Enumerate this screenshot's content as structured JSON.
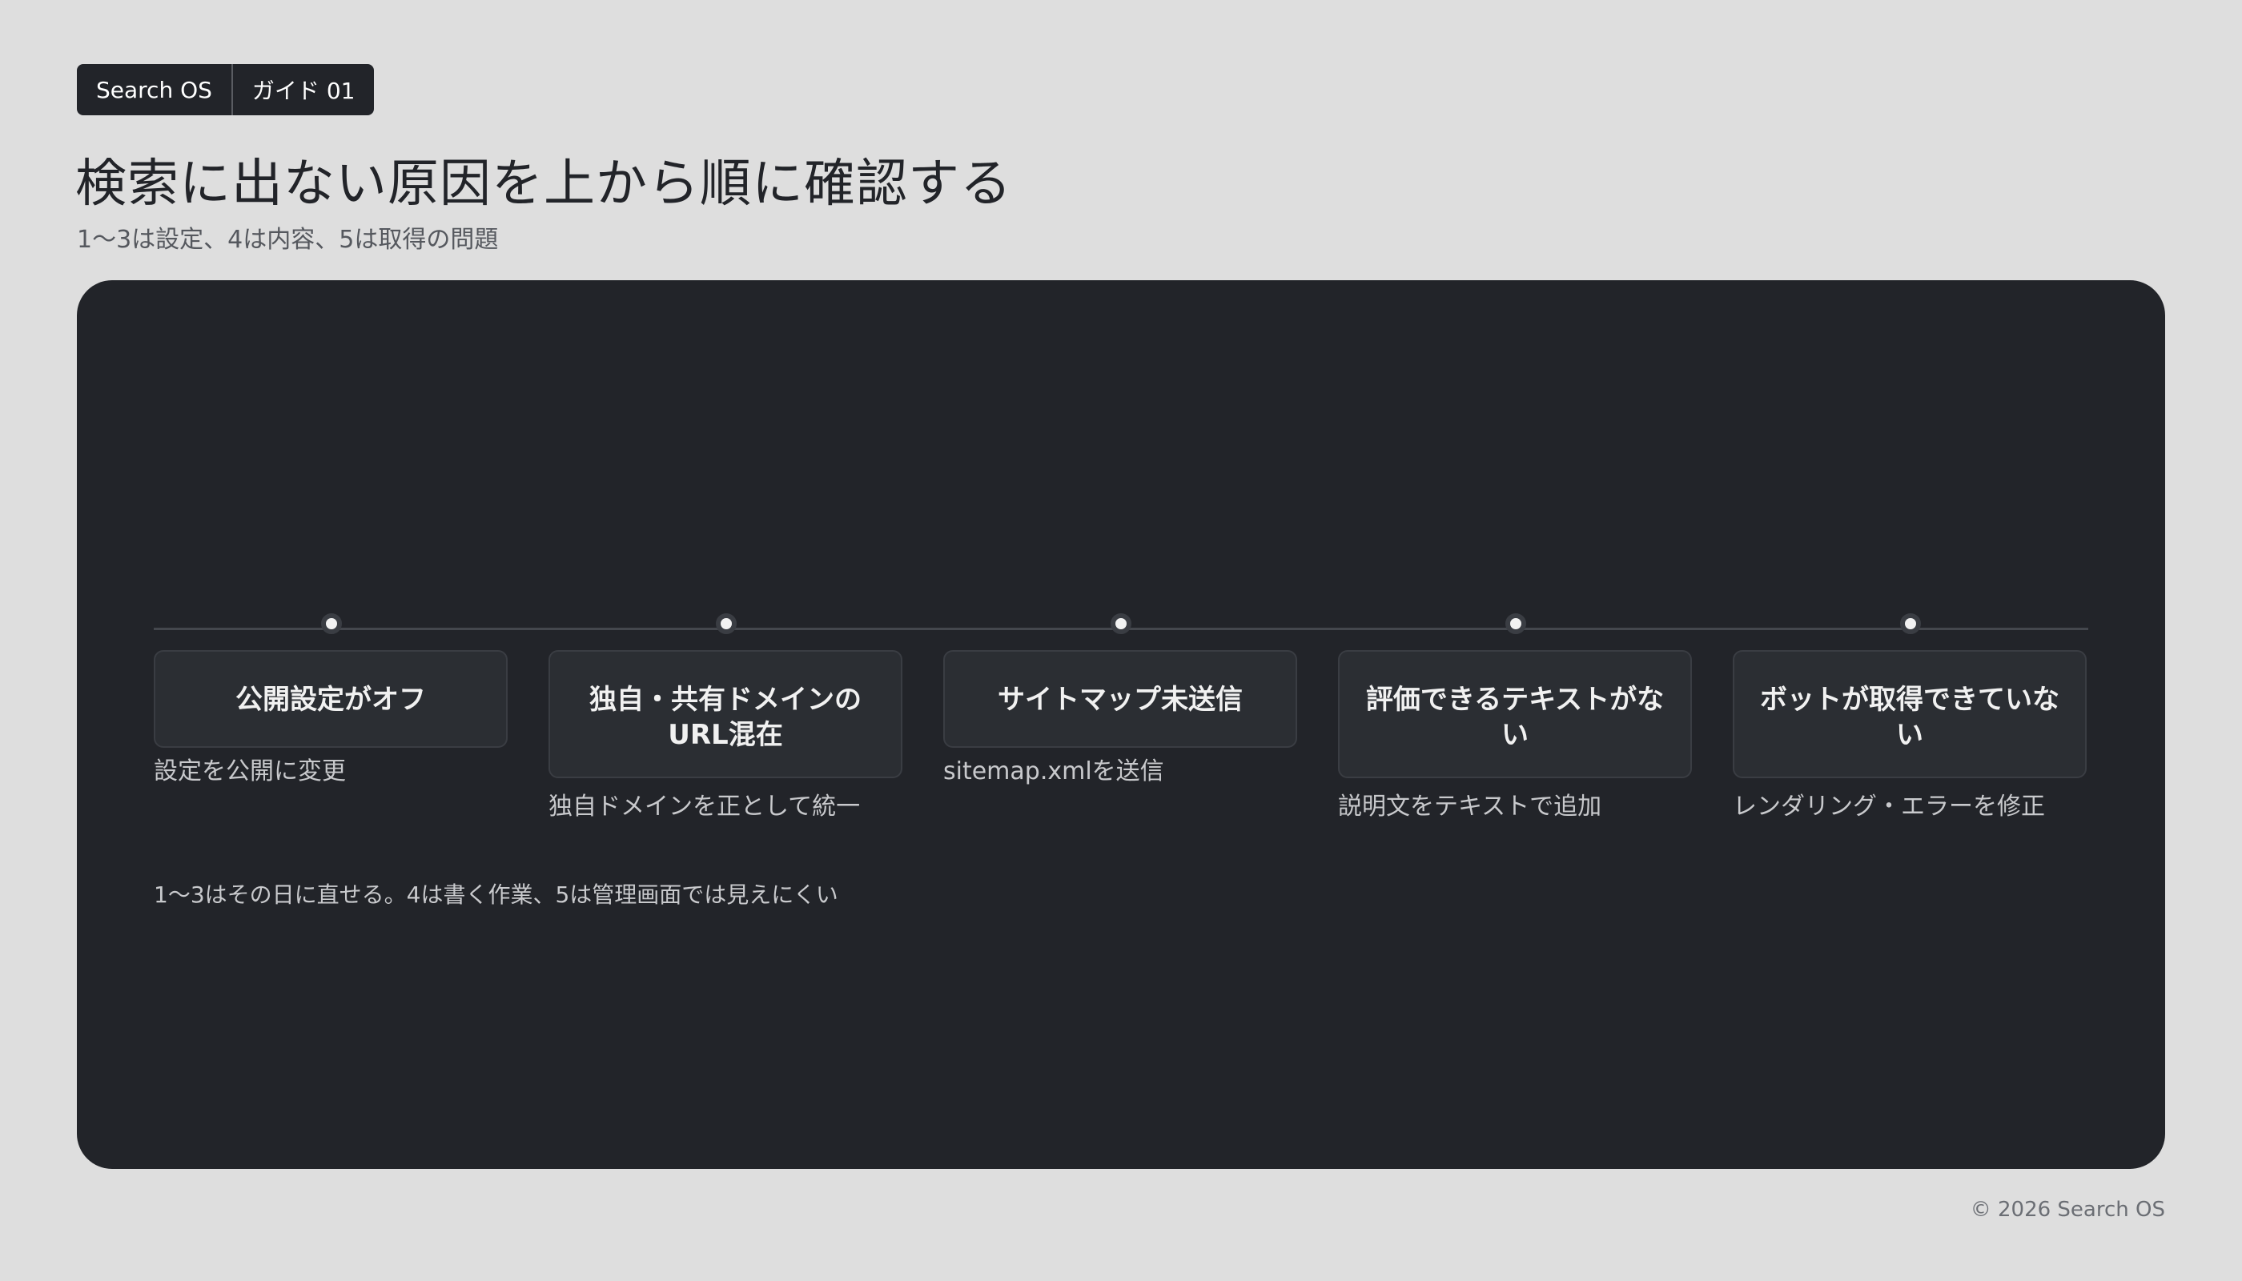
{
  "badge": {
    "brand": "Search OS",
    "guide": "ガイド 01"
  },
  "page": {
    "title": "検索に出ない原因を上から順に確認する",
    "subtitle": "1〜3は設定、4は内容、5は取得の問題"
  },
  "steps": [
    {
      "title": "公開設定がオフ",
      "description": "設定を公開に変更"
    },
    {
      "title": "独自・共有ドメインのURL混在",
      "description": "独自ドメインを正として統一"
    },
    {
      "title": "サイトマップ未送信",
      "description": "sitemap.xmlを送信"
    },
    {
      "title": "評価できるテキストがない",
      "description": "説明文をテキストで追加"
    },
    {
      "title": "ボットが取得できていない",
      "description": "レンダリング・エラーを修正"
    }
  ],
  "note": "1〜3はその日に直せる。4は書く作業、5は管理画面では見えにくい",
  "footer": "© 2026 Search OS",
  "colors": {
    "background": "#dedede",
    "panel": "#222429",
    "card": "#2b2e33",
    "line": "#44474d",
    "text": "#222429",
    "muted_text": "#c8c9cc"
  }
}
